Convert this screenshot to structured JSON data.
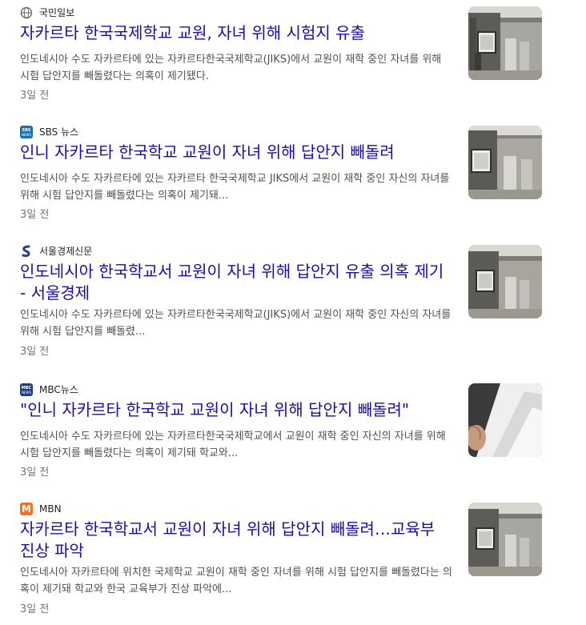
{
  "articles": [
    {
      "source": "국민일보",
      "icon": "globe-icon",
      "headline": "자카르타 한국국제학교 교원, 자녀 위해 시험지 유출",
      "snippet": "인도네시아 수도 자카르타에 있는 자카르타한국국제학교(JIKS)에서 교원이 재학 중인 자녀를 위해 시험 답안지를 빼돌렸다는 의혹이 제기됐다.",
      "age": "3일 전",
      "thumbnail": "school-gate-photo"
    },
    {
      "source": "SBS 뉴스",
      "icon": "sbs-news-logo-icon",
      "headline": "인니 자카르타 한국학교 교원이 자녀 위해 답안지 빼돌려",
      "snippet": "인도네시아 수도 자카르타에 있는 자카르타 한국국제학교 JIKS에서 교원이 재학 중인 자신의 자녀를 위해 시험 답안지를 빼돌렸다는 의혹이 제기돼...",
      "age": "3일 전",
      "thumbnail": "school-gate-photo"
    },
    {
      "source": "서울경제신문",
      "icon": "seoul-economic-logo-icon",
      "headline": "인도네시아 한국학교서 교원이 자녀 위해 답안지 유출 의혹 제기 - 서울경제",
      "snippet": "인도네시아 수도 자카르타에 있는 자카르타한국국제학교(JIKS)에서 교원이 재학 중인 자신의 자녀를 위해 시험 답안지를 빼돌렸...",
      "age": "3일 전",
      "thumbnail": "school-gate-photo"
    },
    {
      "source": "MBC뉴스",
      "icon": "mbc-news-logo-icon",
      "headline": "\"인니 자카르타 한국학교 교원이 자녀 위해 답안지 빼돌려\"",
      "snippet": "인도네시아 수도 자카르타에 있는 자카르타한국국제학교에서 교원이 재학 중인 자신의 자녀를 위해 시험 답안지를 빼돌렸다는 의혹이 제기돼 학교와...",
      "age": "3일 전",
      "thumbnail": "paper-sheets-photo"
    },
    {
      "source": "MBN",
      "icon": "mbn-logo-icon",
      "headline": "자카르타 한국학교서 교원이 자녀 위해 답안지 빼돌려…교육부 진상 파악",
      "snippet": "인도네시아 자카르타에 위치한 국제학교 교원이 재학 중인 자녀를 위해 시험 답안지를 빼돌렸다는 의혹이 제기돼 학교와 한국 교육부가 진상 파악에...",
      "age": "3일 전",
      "thumbnail": "school-gate-photo"
    }
  ],
  "logos": {
    "sbs": "SBS",
    "sbs_sub": "NEWS",
    "mbc": "MBC",
    "mbc_sub": "NEWS",
    "mbn": "M"
  },
  "colors": {
    "headline": "#1a0dab",
    "snippet": "#4d5156",
    "age": "#70757a",
    "sbs": "#1a6fb5",
    "mbc": "#1f3c88",
    "mbn": "#f36f21",
    "seoul": "#2a3f8f"
  }
}
